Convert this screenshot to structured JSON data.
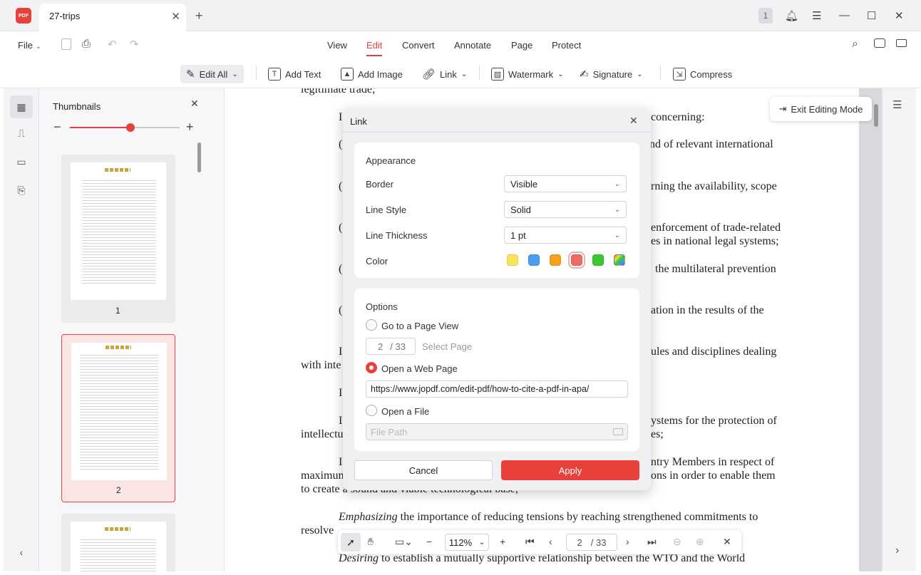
{
  "tab": {
    "title": "27-trips",
    "app_logo": "PDF"
  },
  "window": {
    "badge": "1"
  },
  "menu": {
    "file": "File",
    "items": [
      "View",
      "Edit",
      "Convert",
      "Annotate",
      "Page",
      "Protect"
    ],
    "active": "Edit"
  },
  "toolbar": {
    "edit_all": "Edit All",
    "add_text": "Add Text",
    "add_image": "Add Image",
    "link": "Link",
    "watermark": "Watermark",
    "signature": "Signature",
    "compress": "Compress"
  },
  "thumbnails": {
    "title": "Thumbnails",
    "pages": [
      "1",
      "2"
    ],
    "zoom_level": 0.55
  },
  "exit_editing": "Exit Editing Mode",
  "document_lines": {
    "l1": "legitimate trade;",
    "l2": "concerning:",
    "l3": "nd of relevant international",
    "l4": "rning the availability, scope",
    "l5a": "enforcement of trade-related",
    "l5b": "es in national legal systems;",
    "l6": "the multilateral prevention",
    "l7": "ation in the results of the",
    "l8a": "ules and disciplines dealing",
    "l8b": "with inte",
    "l9a": "ystems for the protection of",
    "l9b": "intellectu",
    "l9c": "es;",
    "l10a": "ntry Members in respect of",
    "l10b": "maximum",
    "l10c": "ons in order to enable them",
    "l10d": "to create a sound and viable technological base;",
    "l11a_em": "Emphasizing",
    "l11a": " the importance of reducing tensions by reaching strengthened commitments to",
    "l11b": "resolve",
    "l12_em": "Desiring",
    "l12": " to establish a mutually supportive relationship between the WTO and the World"
  },
  "link_dialog": {
    "title": "Link",
    "appearance": {
      "heading": "Appearance",
      "border_label": "Border",
      "border_value": "Visible",
      "line_style_label": "Line Style",
      "line_style_value": "Solid",
      "thickness_label": "Line Thickness",
      "thickness_value": "1 pt",
      "color_label": "Color",
      "colors": [
        "#f9e45c",
        "#4a9df0",
        "#f5a11c",
        "#f26b63",
        "#3cc72f"
      ],
      "selected_color": "#f26b63"
    },
    "options": {
      "heading": "Options",
      "go_to_page": "Go to a Page View",
      "page_current": "2",
      "page_total": "/ 33",
      "select_page": "Select Page",
      "open_web": "Open a Web Page",
      "url": "https://www.jopdf.com/edit-pdf/how-to-cite-a-pdf-in-apa/",
      "open_file": "Open a File",
      "file_path_placeholder": "File Path",
      "selected": "open_web"
    },
    "cancel": "Cancel",
    "apply": "Apply"
  },
  "bottom": {
    "zoom": "112%",
    "page_current": "2",
    "page_total": "/ 33"
  }
}
